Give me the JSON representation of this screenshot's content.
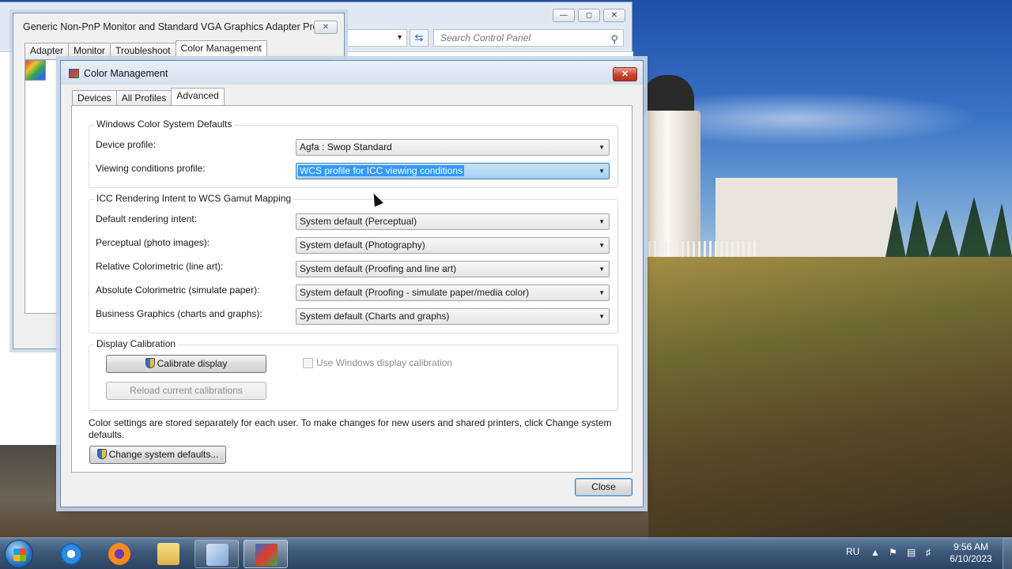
{
  "desktop": {
    "wallpaper": "lighthouse-landscape"
  },
  "control_panel": {
    "search_placeholder": "Search Control Panel"
  },
  "monitor_dialog": {
    "title": "Generic Non-PnP Monitor and Standard VGA Graphics Adapter Pro...",
    "tabs": [
      "Adapter",
      "Monitor",
      "Troubleshoot",
      "Color Management"
    ],
    "active_tab": "Color Management"
  },
  "color_management": {
    "title": "Color Management",
    "tabs": [
      "Devices",
      "All Profiles",
      "Advanced"
    ],
    "active_tab": "Advanced",
    "wcs_defaults": {
      "heading": "Windows Color System Defaults",
      "device_profile_label": "Device profile:",
      "device_profile_value": "Agfa : Swop Standard",
      "viewing_conditions_label": "Viewing conditions profile:",
      "viewing_conditions_value": "WCS profile for ICC viewing conditions"
    },
    "icc_mapping": {
      "heading": "ICC Rendering Intent to WCS Gamut Mapping",
      "rows": [
        {
          "label": "Default rendering intent:",
          "value": "System default (Perceptual)"
        },
        {
          "label": "Perceptual (photo images):",
          "value": "System default (Photography)"
        },
        {
          "label": "Relative Colorimetric (line art):",
          "value": "System default (Proofing and line art)"
        },
        {
          "label": "Absolute Colorimetric (simulate paper):",
          "value": "System default (Proofing - simulate paper/media color)"
        },
        {
          "label": "Business Graphics (charts and graphs):",
          "value": "System default (Charts and graphs)"
        }
      ]
    },
    "calibration": {
      "heading": "Display Calibration",
      "calibrate_button": "Calibrate display",
      "reload_button": "Reload current calibrations",
      "use_windows_calibration_label": "Use Windows display calibration",
      "use_windows_calibration_checked": false
    },
    "info_text": "Color settings are stored separately for each user. To make changes for new users and shared printers, click Change system defaults.",
    "change_defaults_button": "Change system defaults...",
    "close_button": "Close"
  },
  "taskbar": {
    "items": [
      "start",
      "internet-explorer",
      "firefox",
      "file-explorer",
      "control-panel",
      "color-management"
    ],
    "language": "RU",
    "time": "9:56 AM",
    "date": "6/10/2023"
  },
  "colors": {
    "accent": "#3399ff",
    "close_red": "#c9442d",
    "taskbar": "#3d5878"
  }
}
